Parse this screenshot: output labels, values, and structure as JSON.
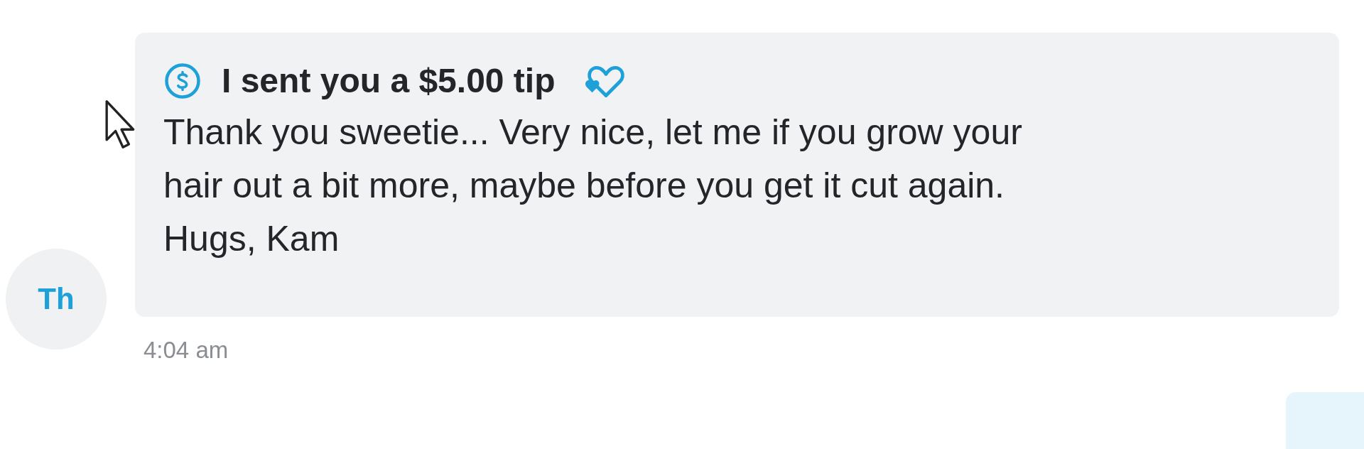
{
  "message": {
    "avatar_initials": "Th",
    "tip_title": "I sent you a $5.00 tip",
    "text": "Thank you sweetie... Very nice, let me if you grow your\nhair out a bit more, maybe before you get it cut again.\nHugs, Kam",
    "time": "4:04 am"
  }
}
